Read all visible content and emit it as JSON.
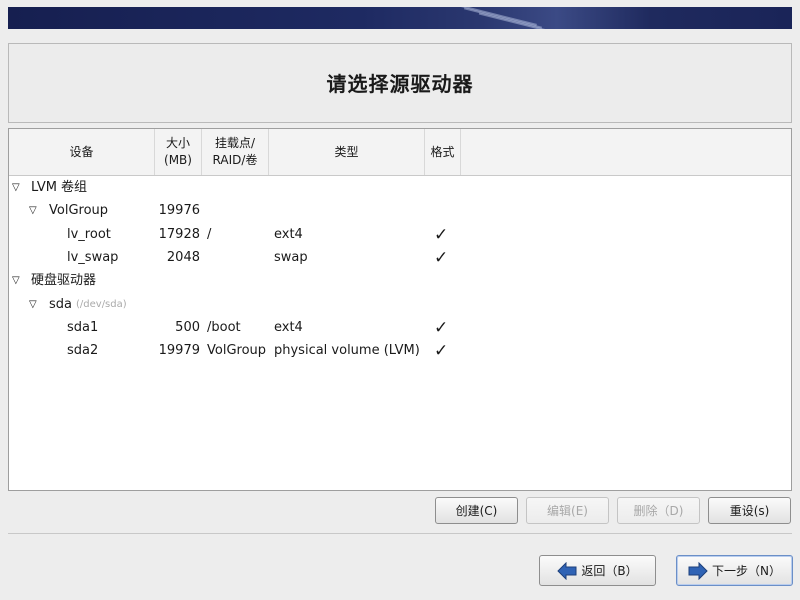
{
  "page": {
    "title": "请选择源驱动器"
  },
  "table": {
    "headers": {
      "device": "设备",
      "size": "大小\n(MB)",
      "mount": "挂载点/\nRAID/卷",
      "type": "类型",
      "format": "格式"
    },
    "groups": [
      {
        "label": "LVM 卷组",
        "expanded": true,
        "children": [
          {
            "name": "VolGroup",
            "size": "19976",
            "expanded": true,
            "children": [
              {
                "name": "lv_root",
                "size": "17928",
                "mount": "/",
                "type": "ext4",
                "format": true
              },
              {
                "name": "lv_swap",
                "size": "2048",
                "mount": "",
                "type": "swap",
                "format": true
              }
            ]
          }
        ]
      },
      {
        "label": "硬盘驱动器",
        "expanded": true,
        "children": [
          {
            "name": "sda",
            "hint": "(/dev/sda)",
            "expanded": true,
            "children": [
              {
                "name": "sda1",
                "size": "500",
                "mount": "/boot",
                "type": "ext4",
                "format": true
              },
              {
                "name": "sda2",
                "size": "19979",
                "mount": "VolGroup",
                "type": "physical volume (LVM)",
                "format": true
              }
            ]
          }
        ]
      }
    ]
  },
  "actions": {
    "create": "创建(C)",
    "edit": "编辑(E)",
    "delete": "删除（D)",
    "reset": "重设(s)"
  },
  "nav": {
    "back": "返回（B）",
    "next": "下一步（N）"
  },
  "colors": {
    "banner": "#1e2a62",
    "background": "#ededed",
    "arrow_blue": "#2f63b5"
  }
}
